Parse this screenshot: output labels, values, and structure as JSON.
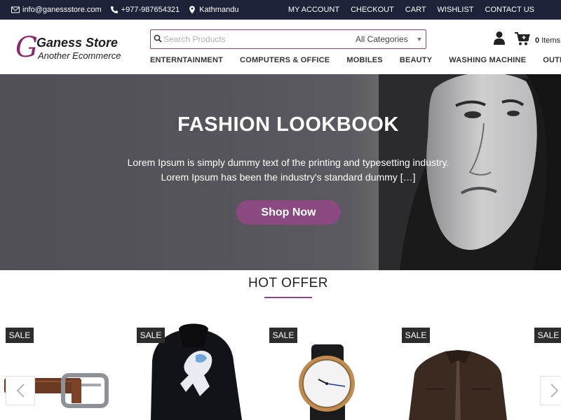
{
  "topbar": {
    "email": "info@ganessstore.com",
    "phone": "+977-987654321",
    "location": "Kathmandu",
    "links": [
      "MY ACCOUNT",
      "CHECKOUT",
      "CART",
      "WISHLIST",
      "CONTACT US"
    ]
  },
  "header": {
    "logo_letter": "G",
    "logo_name": "Ganess Store",
    "logo_tagline": "Another Ecommerce",
    "search_placeholder": "Search Products",
    "category_selected": "All Categories",
    "cart_count": "0",
    "cart_label": "Items"
  },
  "nav": [
    "ENTERNTAINMENT",
    "COMPUTERS & OFFICE",
    "MOBILES",
    "BEAUTY",
    "WASHING MACHINE",
    "OUTDOOR"
  ],
  "hero": {
    "title": "FASHION LOOKBOOK",
    "text": "Lorem Ipsum is simply dummy text of the printing and typesetting industry. Lorem Ipsum has been the industry's standard dummy […]",
    "button": "Shop Now"
  },
  "offer": {
    "title": "HOT OFFER",
    "sale_label": "SALE",
    "products": [
      "belt",
      "hoodie",
      "watch",
      "jacket",
      "item"
    ]
  },
  "colors": {
    "topbar": "#1e2239",
    "accent": "#8a4a80",
    "sale_badge": "#2d2d2d"
  },
  "icons": [
    "envelope-icon",
    "phone-icon",
    "location-icon",
    "search-icon",
    "user-icon",
    "cart-icon",
    "chevron-left-icon",
    "chevron-right-icon"
  ]
}
